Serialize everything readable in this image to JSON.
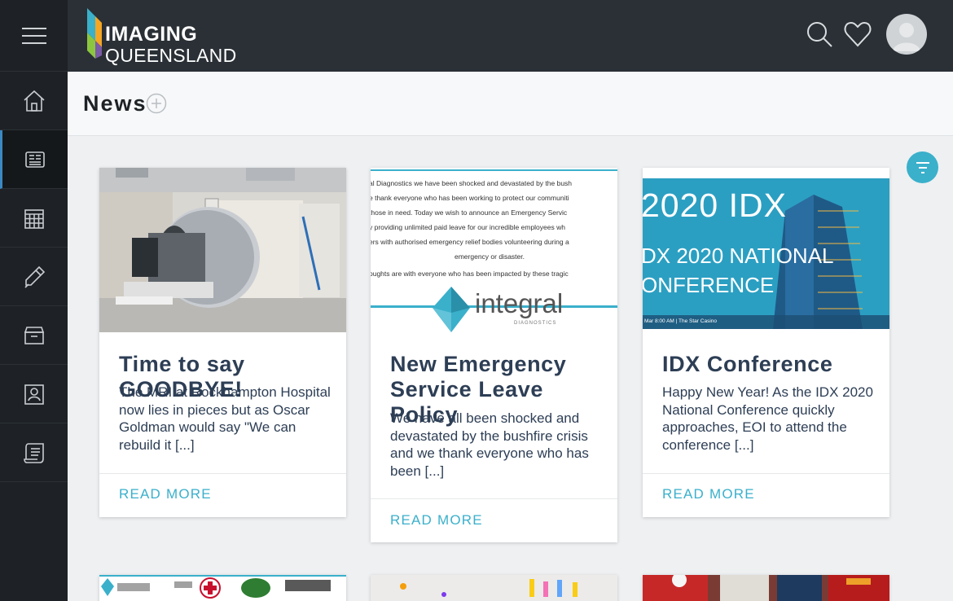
{
  "app": {
    "logo_line1": "IMAGING",
    "logo_line2": "QUEENSLAND"
  },
  "sidebar": {
    "items": [
      {
        "icon": "home-icon"
      },
      {
        "icon": "news-icon",
        "active": true
      },
      {
        "icon": "calendar-icon"
      },
      {
        "icon": "pen-icon"
      },
      {
        "icon": "archive-icon"
      },
      {
        "icon": "contacts-icon"
      },
      {
        "icon": "scroll-icon"
      }
    ]
  },
  "page": {
    "title": "News"
  },
  "cards": [
    {
      "title": "Time to say GOODBYE!",
      "excerpt": "The MRI at Rockhampton Hospital now lies in pieces but as Oscar Goldman would say \"We can rebuild it [...]",
      "read_more": "READ MORE"
    },
    {
      "title": "New Emergency Service Leave Policy",
      "excerpt": "We have all been shocked and devastated by the bushfire crisis and we thank everyone who has been [...]",
      "read_more": "READ MORE",
      "image_text": {
        "l1": "al Diagnostics we have been shocked and devastated by the bush",
        "l2": "e thank everyone who has been working to protect our communiti",
        "l3": "those in need. Today we wish to announce an Emergency Servic",
        "l4": "y providing unlimited paid leave for our incredible employees wh",
        "l5": "ers with authorised emergency relief bodies volunteering during a",
        "l6": "emergency or disaster.",
        "l7": "oughts are with everyone who has been impacted by these tragic",
        "brand": "integral",
        "brand_sub": "DIAGNOSTICS"
      }
    },
    {
      "title": "IDX Conference",
      "excerpt": "Happy New Year! As the IDX 2020 National Conference quickly approaches, EOI to attend the conference [...]",
      "read_more": "READ MORE",
      "image_text": {
        "line1": "2020 IDX",
        "line2": "DX 2020 NATIONAL",
        "line3": "ONFERENCE",
        "date": "Mar 8:00 AM  |  The Star Casino"
      }
    }
  ],
  "colors": {
    "accent": "#3ab0cb",
    "sidebar_bg": "#1e2226",
    "topbar_bg": "#2a3036",
    "title_text": "#2d3e55"
  }
}
